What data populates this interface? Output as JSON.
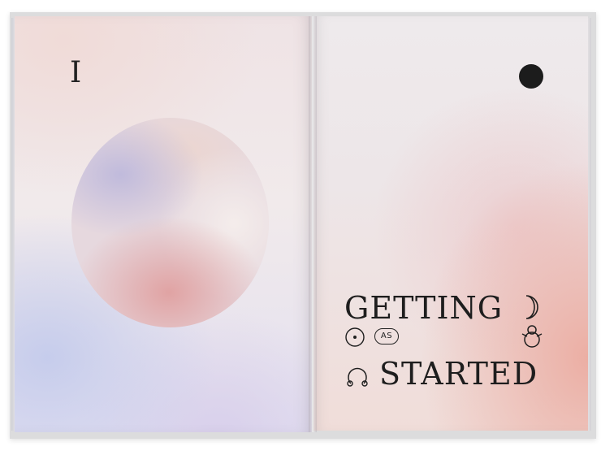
{
  "left_page": {
    "numeral": "I"
  },
  "right_page": {
    "title_line_1": "GETTING",
    "connector": "AS",
    "title_line_2": "STARTED",
    "icons": [
      "black-dot",
      "crescent-moon-icon",
      "dot-circle-icon",
      "double-ring-icon",
      "omega-ring-icon"
    ]
  },
  "colors": {
    "ink": "#1e1e1e",
    "peach": "#ebaba0",
    "lavender": "#c4cbec",
    "blush": "#efe3e5"
  }
}
